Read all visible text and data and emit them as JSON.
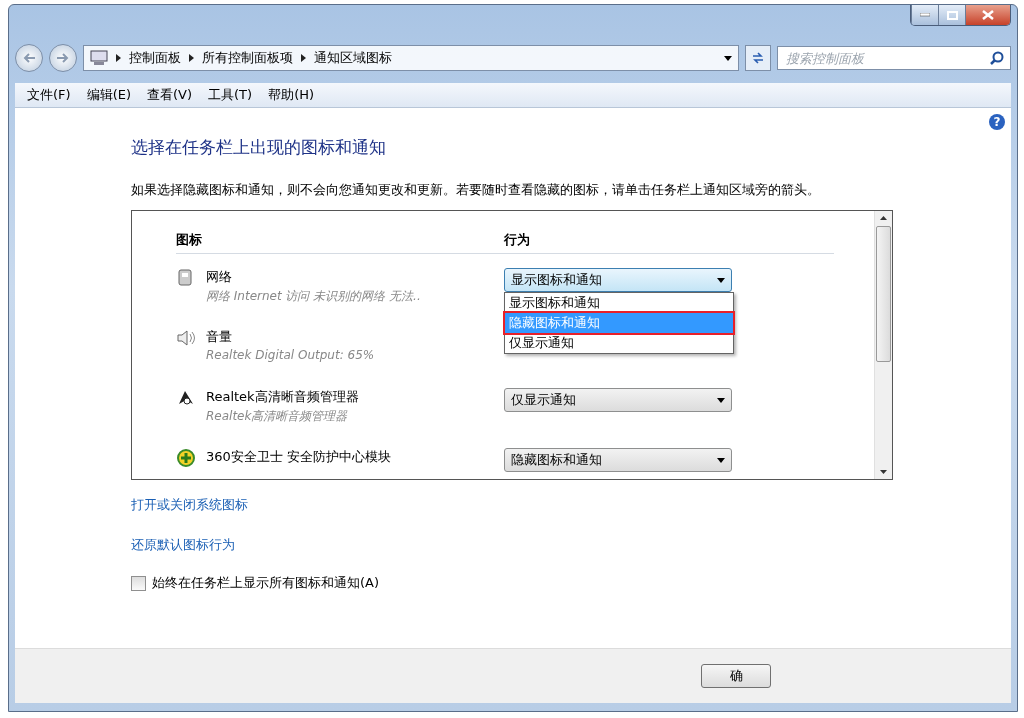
{
  "help_button": "?",
  "address_bar": {
    "breadcrumbs": [
      "控制面板",
      "所有控制面板项",
      "通知区域图标"
    ],
    "search_placeholder": "搜索控制面板"
  },
  "menu": [
    "文件(F)",
    "编辑(E)",
    "查看(V)",
    "工具(T)",
    "帮助(H)"
  ],
  "heading": "选择在任务栏上出现的图标和通知",
  "description": "如果选择隐藏图标和通知，则不会向您通知更改和更新。若要随时查看隐藏的图标，请单击任务栏上通知区域旁的箭头。",
  "table": {
    "columns": [
      "图标",
      "行为"
    ],
    "rows": [
      {
        "kind": "network",
        "name": "网络",
        "detail": "网络 Internet 访问 未识别的网络 无法..",
        "behavior": "显示图标和通知",
        "expanded": true,
        "options": [
          {
            "label": "显示图标和通知",
            "selected": false
          },
          {
            "label": "隐藏图标和通知",
            "selected": true
          },
          {
            "label": "仅显示通知",
            "selected": false
          }
        ]
      },
      {
        "kind": "speaker",
        "name": "音量",
        "detail": "Realtek Digital Output: 65%",
        "expanded": false
      },
      {
        "kind": "audio-manager",
        "name": "Realtek高清晰音频管理器",
        "detail": "Realtek高清晰音频管理器",
        "behavior": "仅显示通知",
        "expanded": false
      },
      {
        "kind": "shield",
        "name": "360安全卫士 安全防护中心模块",
        "behavior": "隐藏图标和通知",
        "expanded": false
      }
    ]
  },
  "links": [
    "打开或关闭系统图标",
    "还原默认图标行为"
  ],
  "always_show": {
    "label": "始终在任务栏上显示所有图标和通知(A)",
    "checked": false
  },
  "buttons": [
    "确"
  ]
}
